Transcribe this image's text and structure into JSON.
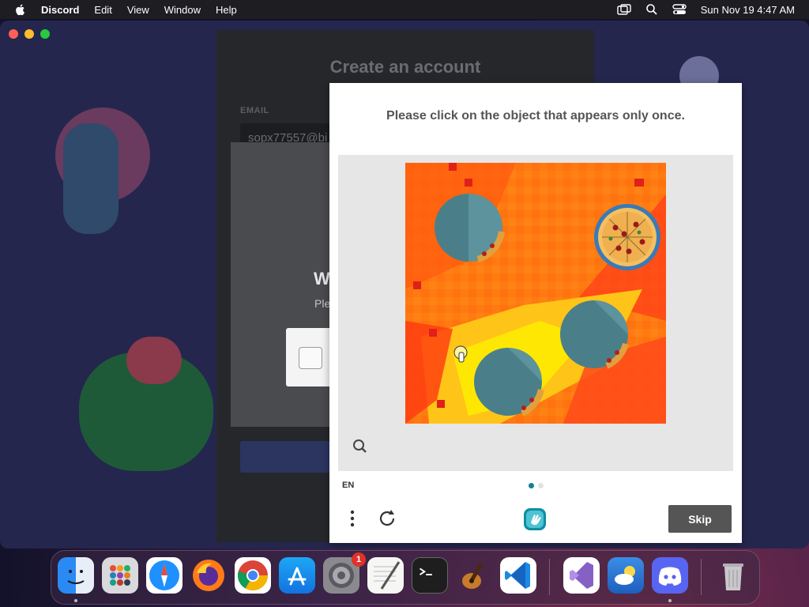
{
  "menubar": {
    "app_name": "Discord",
    "items": [
      "Edit",
      "View",
      "Window",
      "Help"
    ],
    "datetime": "Sun Nov 19  4:47 AM"
  },
  "discord": {
    "title": "Create an account",
    "email_label": "EMAIL",
    "email_value": "sopx77557@bi",
    "verify_heading": "W",
    "verify_subtext": "Ple"
  },
  "captcha": {
    "prompt": "Please click on the object that appears only once.",
    "language": "EN",
    "skip_label": "Skip",
    "image_subject": "pizza",
    "colors": {
      "skip_bg": "#555555",
      "pager_active": "#14808e"
    }
  },
  "dock": {
    "items": [
      {
        "name": "finder",
        "running": true
      },
      {
        "name": "launchpad",
        "running": false
      },
      {
        "name": "safari",
        "running": false
      },
      {
        "name": "firefox",
        "running": false
      },
      {
        "name": "chrome",
        "running": false
      },
      {
        "name": "app-store",
        "running": false
      },
      {
        "name": "system-settings",
        "running": false,
        "badge": "1"
      },
      {
        "name": "textedit",
        "running": false
      },
      {
        "name": "terminal",
        "running": false
      },
      {
        "name": "garageband",
        "running": false
      },
      {
        "name": "vscode",
        "running": false
      },
      {
        "name": "visual-studio",
        "running": false
      },
      {
        "name": "weather",
        "running": false
      },
      {
        "name": "discord",
        "running": true
      },
      {
        "name": "trash",
        "running": false
      }
    ]
  }
}
